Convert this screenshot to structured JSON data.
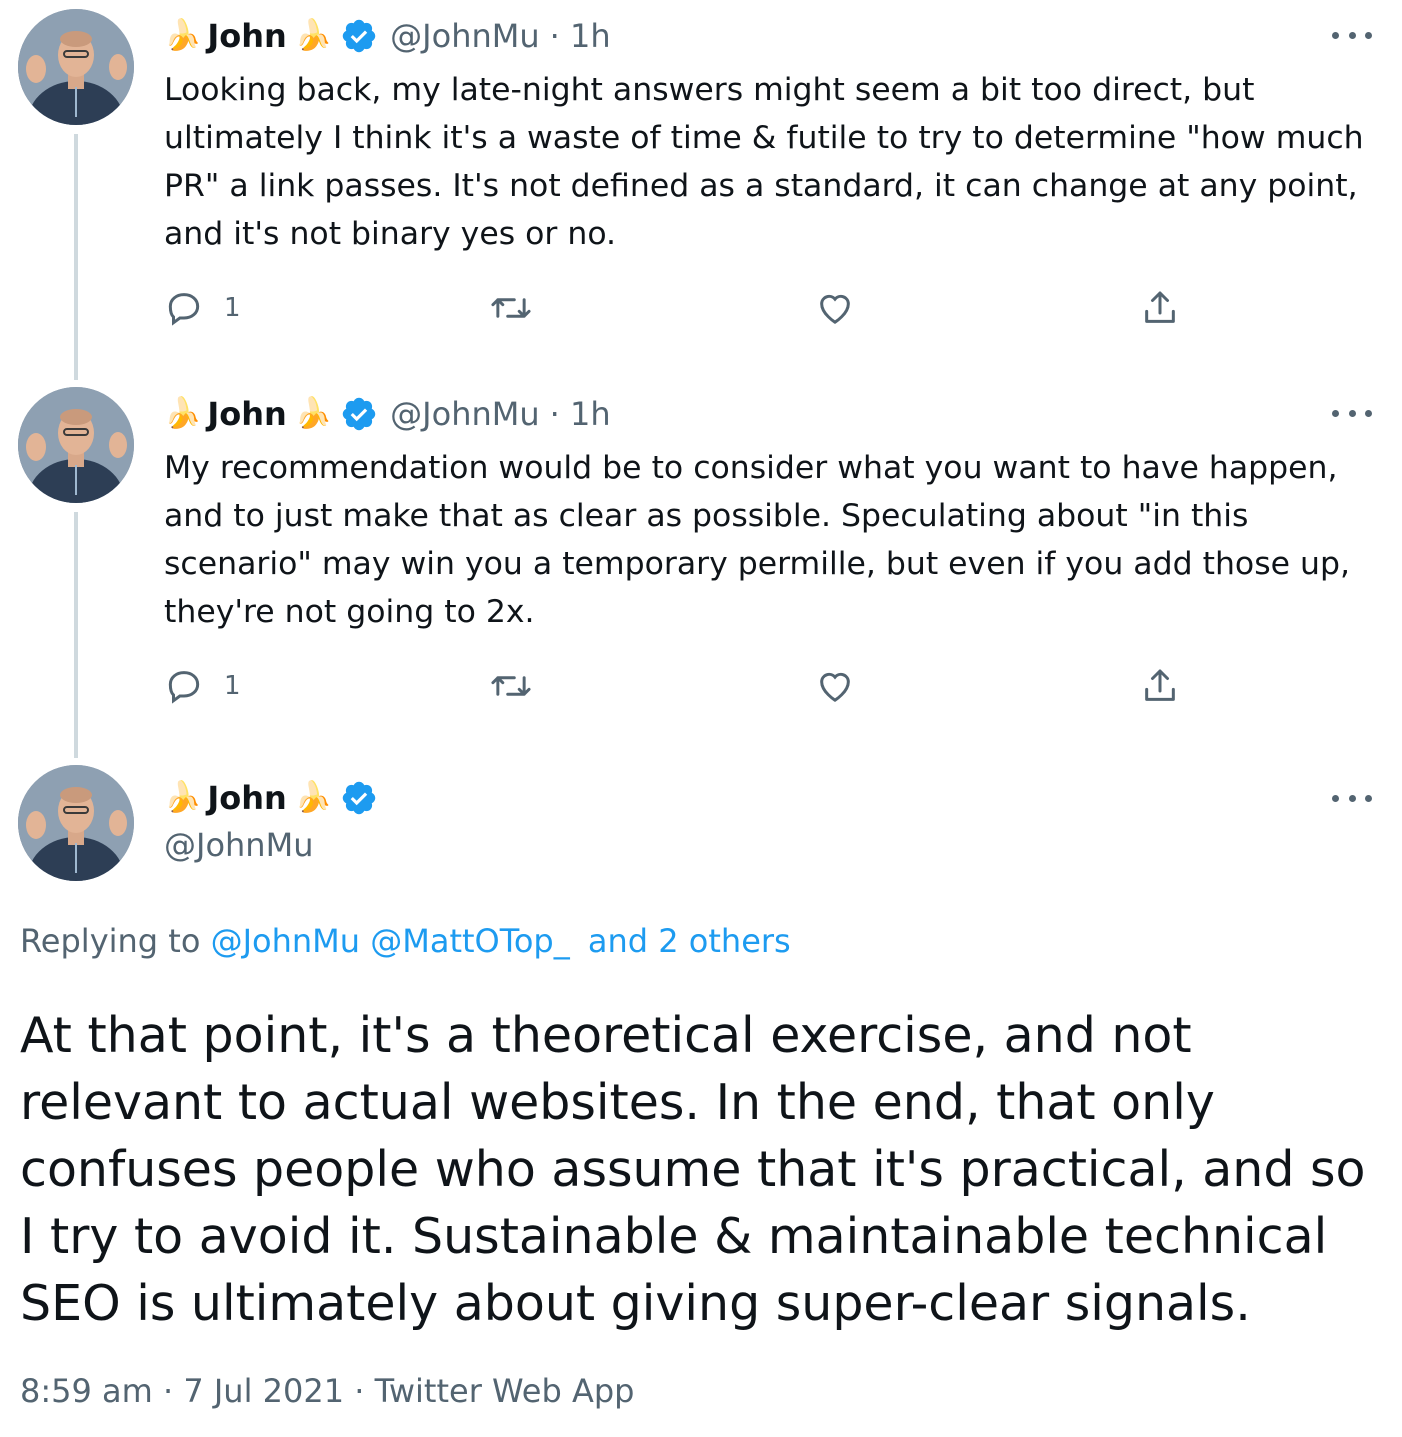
{
  "tweets": [
    {
      "name": "John",
      "handle": "@JohnMu",
      "time": "· 1h",
      "text": "Looking back, my late-night answers might seem a bit too direct, but ultimately I think it's a waste of time & futile to try to determine \"how much PR\" a link passes. It's not defined as a standard, it can change at any point, and it's not binary yes or no.",
      "reply_count": "1"
    },
    {
      "name": "John",
      "handle": "@JohnMu",
      "time": "· 1h",
      "text": "My recommendation would be to consider what you want to have happen, and to just make that as clear as possible. Speculating about \"in this scenario\" may win you a temporary permille, but even if you add those up, they're not going to 2x.",
      "reply_count": "1"
    }
  ],
  "main_tweet": {
    "name": "John",
    "handle": "@JohnMu",
    "replying_prefix": "Replying to",
    "replying_user1": "@JohnMu",
    "replying_user2": "@MattOTop_",
    "replying_others": "and 2 others",
    "text": "At that point, it's a theoretical exercise, and not relevant to actual websites. In the end, that only confuses people who assume that it's practical, and so I try to avoid it. Sustainable & maintainable technical SEO is ultimately about giving super-clear signals.",
    "timestamp": "8:59 am · 7 Jul 2021 · Twitter Web App"
  },
  "decorations": {
    "name_emoji": "🍌",
    "verified_color": "#1d9bf0",
    "link_color": "#1d9bf0",
    "secondary_text_color": "#536471"
  }
}
